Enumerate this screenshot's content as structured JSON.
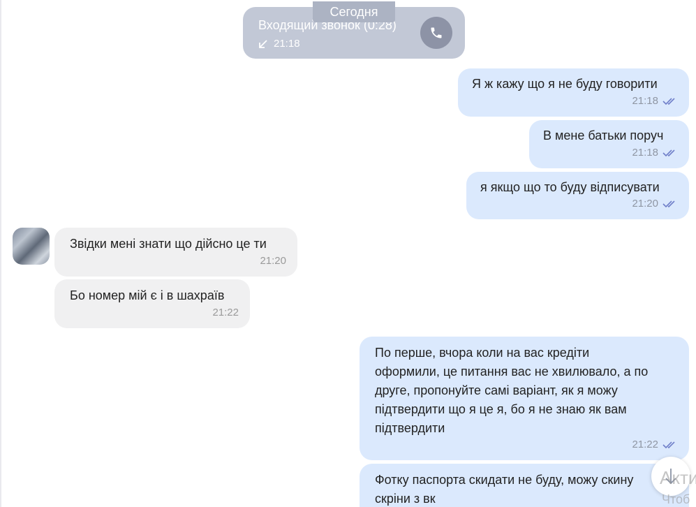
{
  "date_separator": "Сегодня",
  "call": {
    "title": "Входящий звонок (0:28)",
    "time": "21:18",
    "direction_icon": "arrow-incoming-icon",
    "button_icon": "phone-icon"
  },
  "messages": [
    {
      "side": "out",
      "text": "Я ж кажу що я не буду говорити",
      "time": "21:18",
      "status": "read"
    },
    {
      "side": "out",
      "text": "В мене батьки поруч",
      "time": "21:18",
      "status": "read"
    },
    {
      "side": "out",
      "text": "я якщо що то буду відписувати",
      "time": "21:20",
      "status": "read"
    },
    {
      "side": "in",
      "text": "Звідки мені знати що дійсно це ти",
      "time": "21:20"
    },
    {
      "side": "in",
      "text": "Бо номер мій є і в шахраїв",
      "time": "21:22"
    },
    {
      "side": "out",
      "lines": [
        "По перше, вчора коли на вас кредіти",
        "оформили, це питання вас не хвилювало, а по",
        "друге, пропонуйте самі варіант, як я можу",
        "підтвердити що я це я, бо я не знаю як вам",
        "підтвердити"
      ],
      "time": "21:22",
      "status": "read"
    },
    {
      "side": "out",
      "lines": [
        "Фотку паспорта скидати не буду, можу скину",
        "скріни з вк"
      ]
    }
  ],
  "scroll_down_icon": "arrow-down-icon",
  "watermark": {
    "line1": "Акти",
    "line2": "Чтоб"
  },
  "colors": {
    "outgoing_bubble": "#dbe9fd",
    "incoming_bubble": "#f0f0f1",
    "call_bubble": "#c2c8d6",
    "date_pill": "#acb3c3",
    "read_ticks": "#6f7fc9"
  }
}
